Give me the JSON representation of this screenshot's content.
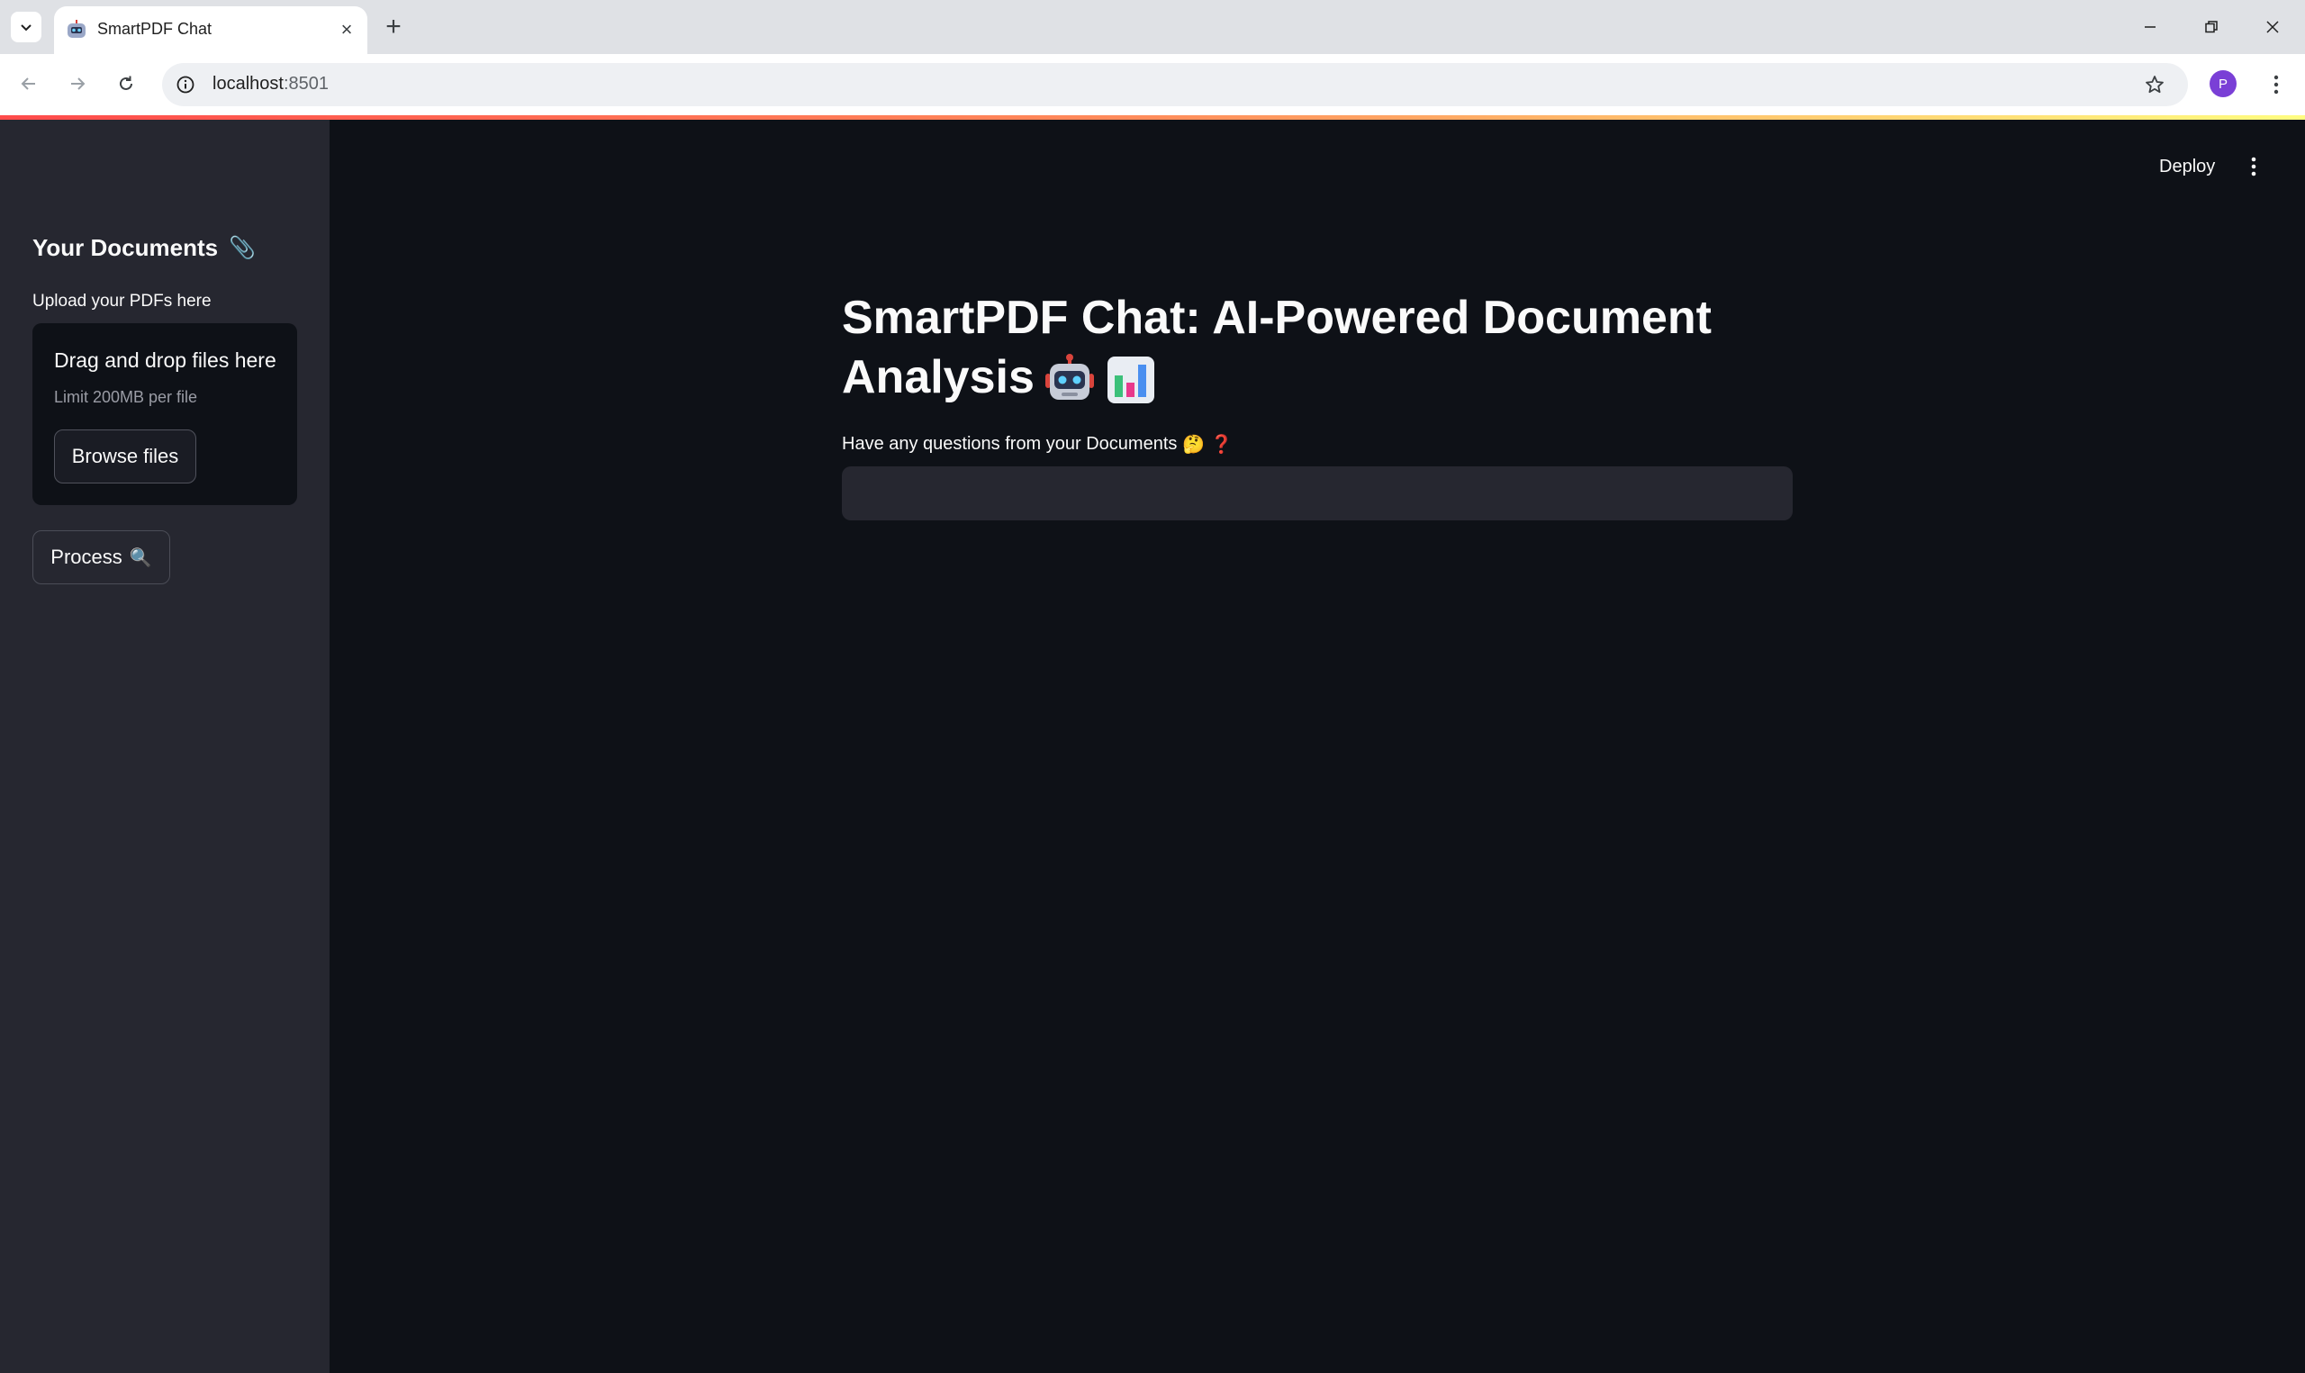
{
  "browser": {
    "tab_title": "SmartPDF Chat",
    "tab_close": "×",
    "new_tab": "+",
    "url_host": "localhost",
    "url_port": ":8501",
    "profile_initial": "P"
  },
  "app": {
    "header": {
      "deploy_label": "Deploy"
    },
    "sidebar": {
      "title": "Your Documents",
      "title_icon": "📎",
      "upload_label": "Upload your PDFs here",
      "dropzone_title": "Drag and drop files here",
      "dropzone_limit": "Limit 200MB per file",
      "browse_label": "Browse files",
      "process_label": "Process",
      "process_icon": "🔍"
    },
    "main": {
      "title_text": "SmartPDF Chat: AI-Powered Document Analysis",
      "title_icons": [
        "robot-icon",
        "bar-chart-icon"
      ],
      "question_label": "Have any questions from your Documents",
      "question_icons": [
        "🤔",
        "❓"
      ],
      "question_value": ""
    }
  },
  "colors": {
    "app_background": "#0e1117",
    "sidebar_background": "#262730",
    "input_background": "#262730",
    "text": "#fafafa",
    "accent_gradient": [
      "#ff4b4b",
      "#fffd80"
    ]
  }
}
